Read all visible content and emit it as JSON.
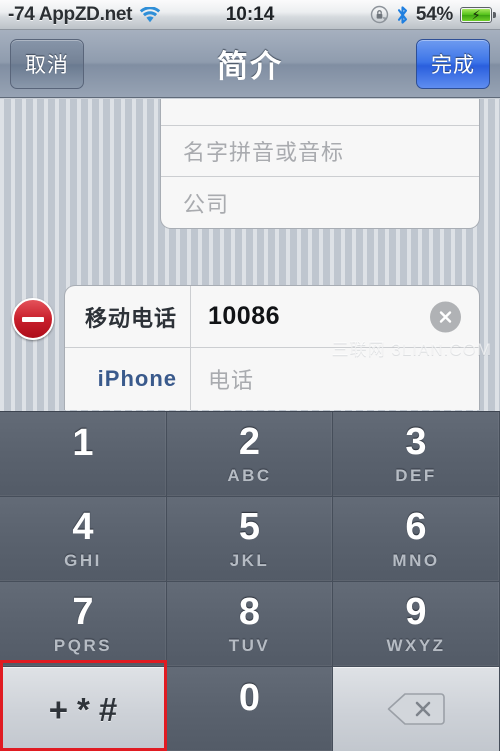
{
  "status_bar": {
    "carrier": "-74 AppZD.net",
    "wifi_icon": "wifi-icon",
    "time": "10:14",
    "rotation_lock_icon": "rotation-lock-icon",
    "bluetooth_icon": "bluetooth-icon",
    "battery_percent": "54%",
    "battery_icon": "battery-charging-icon"
  },
  "nav_bar": {
    "cancel_label": "取消",
    "title": "简介",
    "done_label": "完成",
    "done_color": "#3c74e8"
  },
  "form": {
    "name_group": {
      "rows": [
        {
          "placeholder": ""
        },
        {
          "placeholder": "名字拼音或音标"
        },
        {
          "placeholder": "公司"
        }
      ]
    },
    "phone_group": {
      "delete_icon": "minus-circle-icon",
      "delete_color": "#c9202c",
      "rows": [
        {
          "label": "移动电话",
          "value": "10086",
          "clear_icon": "clear-circle-icon"
        },
        {
          "label": "iPhone",
          "placeholder": "电话"
        }
      ]
    }
  },
  "watermark": "三联网 3LIAN.COM",
  "keypad": {
    "keys": [
      {
        "digit": "1",
        "letters": ""
      },
      {
        "digit": "2",
        "letters": "ABC"
      },
      {
        "digit": "3",
        "letters": "DEF"
      },
      {
        "digit": "4",
        "letters": "GHI"
      },
      {
        "digit": "5",
        "letters": "JKL"
      },
      {
        "digit": "6",
        "letters": "MNO"
      },
      {
        "digit": "7",
        "letters": "PQRS"
      },
      {
        "digit": "8",
        "letters": "TUV"
      },
      {
        "digit": "9",
        "letters": "WXYZ"
      },
      {
        "symbol": "+*#"
      },
      {
        "digit": "0",
        "letters": ""
      },
      {
        "icon": "backspace-icon"
      }
    ]
  },
  "annotation": {
    "highlight_color": "#e01b22",
    "target": "+*#"
  }
}
